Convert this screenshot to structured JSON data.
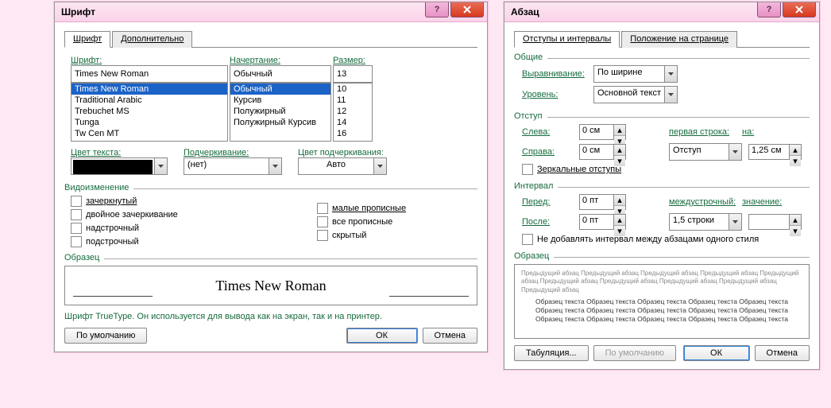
{
  "font_dialog": {
    "title": "Шрифт",
    "tabs": {
      "font": "Шрифт",
      "advanced": "Дополнительно"
    },
    "labels": {
      "font": "Шрифт:",
      "style": "Начертание:",
      "size": "Размер:",
      "font_color": "Цвет текста:",
      "underline": "Подчеркивание:",
      "underline_color": "Цвет подчеркивания:",
      "effects": "Видоизменение",
      "sample": "Образец"
    },
    "font_value": "Times New Roman",
    "font_list": [
      "Times New Roman",
      "Traditional Arabic",
      "Trebuchet MS",
      "Tunga",
      "Tw Cen MT"
    ],
    "style_value": "Обычный",
    "style_list": [
      "Обычный",
      "Курсив",
      "Полужирный",
      "Полужирный Курсив"
    ],
    "size_value": "13",
    "size_list": [
      "10",
      "11",
      "12",
      "14",
      "16"
    ],
    "underline_value": "(нет)",
    "underline_color_value": "Авто",
    "effects": {
      "strike": "зачеркнутый",
      "double_strike": "двойное зачеркивание",
      "superscript": "надстрочный",
      "subscript": "подстрочный",
      "small_caps": "малые прописные",
      "all_caps": "все прописные",
      "hidden": "скрытый"
    },
    "sample_text": "Times New Roman",
    "footer_text": "Шрифт TrueType. Он используется для вывода как на экран, так и на принтер.",
    "buttons": {
      "defaults": "По умолчанию",
      "ok": "ОК",
      "cancel": "Отмена"
    }
  },
  "para_dialog": {
    "title": "Абзац",
    "tabs": {
      "indents": "Отступы и интервалы",
      "position": "Положение на странице"
    },
    "groups": {
      "general": "Общие",
      "indent": "Отступ",
      "spacing": "Интервал",
      "sample": "Образец"
    },
    "labels": {
      "alignment": "Выравнивание:",
      "outline": "Уровень:",
      "left": "Слева:",
      "right": "Справа:",
      "first_line": "первая строка:",
      "by": "на:",
      "mirror": "Зеркальные отступы",
      "before": "Перед:",
      "after": "После:",
      "line_spacing": "междустрочный:",
      "at": "значение:",
      "no_space": "Не добавлять интервал между абзацами одного стиля"
    },
    "values": {
      "alignment": "По ширине",
      "outline": "Основной текст",
      "left": "0 см",
      "right": "0 см",
      "first_line": "Отступ",
      "by": "1,25 см",
      "before": "0 пт",
      "after": "0 пт",
      "line_spacing": "1,5 строки",
      "at": ""
    },
    "sample_light": "Предыдущий абзац Предыдущий абзац Предыдущий абзац Предыдущий абзац Предыдущий абзац Предыдущий абзац Предыдущий абзац Предыдущий абзац Предыдущий абзац Предыдущий абзац",
    "sample_dark": "Образец текста Образец текста Образец текста Образец текста Образец текста Образец текста Образец текста Образец текста Образец текста Образец текста Образец текста Образец текста Образец текста Образец текста Образец текста",
    "buttons": {
      "tabs": "Табуляция...",
      "defaults": "По умолчанию",
      "ok": "ОК",
      "cancel": "Отмена"
    }
  }
}
